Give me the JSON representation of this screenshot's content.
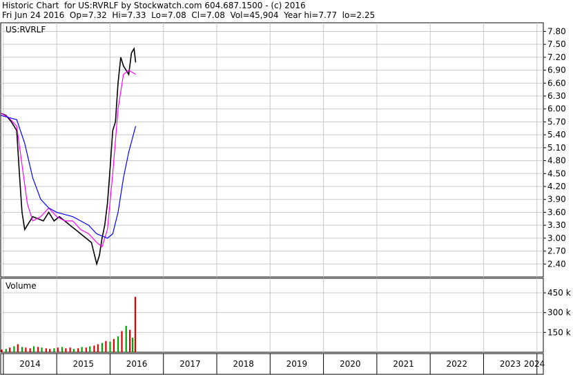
{
  "header": {
    "line1": "Historic Chart  for US:RVRLF by Stockwatch.com 604.687.1500 - (c) 2016",
    "line2": "Fri Jun 24 2016  Op=7.32  Hi=7.33  Lo=7.08  Cl=7.08  Vol=45,904  Year hi=7.77  lo=2.25"
  },
  "chart_data": [
    {
      "type": "line",
      "title": "US:RVRLF",
      "y_ticks": [
        "7.80",
        "7.50",
        "7.20",
        "6.90",
        "6.60",
        "6.30",
        "6.00",
        "5.70",
        "5.40",
        "5.10",
        "4.80",
        "4.50",
        "4.20",
        "3.90",
        "3.60",
        "3.30",
        "3.00",
        "2.70",
        "2.40"
      ],
      "ylim": [
        2.1,
        8.0
      ],
      "x_labels": [
        "2014",
        "2015",
        "2016",
        "2017",
        "2018",
        "2019",
        "2020",
        "2021",
        "2022",
        "2023",
        "2024"
      ],
      "grid": true,
      "colors": {
        "price_bars": "#000000",
        "ma_short": "#ff00ff",
        "ma_long": "#0000ff"
      },
      "series": [
        {
          "x": [
            2013.95,
            2014.05,
            2014.15,
            2014.25,
            2014.3,
            2014.35,
            2014.4,
            2014.45,
            2014.55,
            2014.65,
            2014.75,
            2014.85,
            2014.95,
            2015.05,
            2015.15,
            2015.25,
            2015.35,
            2015.45,
            2015.55,
            2015.65,
            2015.75,
            2015.8,
            2015.85,
            2015.9,
            2015.95,
            2016.0,
            2016.05,
            2016.1,
            2016.15,
            2016.2,
            2016.25,
            2016.3,
            2016.35,
            2016.4,
            2016.45,
            2016.48
          ],
          "values": [
            5.9,
            5.85,
            5.7,
            5.5,
            4.5,
            3.6,
            3.2,
            3.3,
            3.5,
            3.45,
            3.4,
            3.6,
            3.4,
            3.5,
            3.4,
            3.3,
            3.2,
            3.1,
            3.0,
            2.9,
            2.4,
            2.6,
            3.0,
            3.3,
            3.8,
            4.6,
            5.5,
            5.7,
            6.6,
            7.2,
            7.0,
            6.9,
            6.8,
            7.3,
            7.4,
            7.08
          ]
        },
        {
          "x": [
            2013.95,
            2014.1,
            2014.25,
            2014.35,
            2014.45,
            2014.55,
            2014.7,
            2014.85,
            2015.0,
            2015.15,
            2015.3,
            2015.45,
            2015.6,
            2015.75,
            2015.85,
            2015.95,
            2016.05,
            2016.15,
            2016.25,
            2016.35,
            2016.48
          ],
          "values": [
            5.9,
            5.8,
            5.6,
            4.7,
            3.8,
            3.4,
            3.5,
            3.7,
            3.5,
            3.4,
            3.4,
            3.2,
            3.1,
            2.9,
            2.8,
            3.2,
            4.5,
            6.0,
            6.8,
            6.9,
            6.8
          ]
        },
        {
          "x": [
            2013.95,
            2014.1,
            2014.25,
            2014.4,
            2014.55,
            2014.7,
            2014.85,
            2015.0,
            2015.15,
            2015.3,
            2015.45,
            2015.6,
            2015.75,
            2015.85,
            2015.95,
            2016.05,
            2016.15,
            2016.25,
            2016.35,
            2016.48
          ],
          "values": [
            5.85,
            5.8,
            5.75,
            5.2,
            4.4,
            3.9,
            3.7,
            3.6,
            3.55,
            3.5,
            3.4,
            3.3,
            3.1,
            3.05,
            3.0,
            3.1,
            3.6,
            4.4,
            5.0,
            5.6
          ]
        }
      ]
    },
    {
      "type": "bar",
      "title": "Volume",
      "y_ticks": [
        "450 k",
        "300 k",
        "150 k"
      ],
      "ylim": [
        0,
        560
      ],
      "x": [
        2013.97,
        2014.05,
        2014.12,
        2014.2,
        2014.27,
        2014.35,
        2014.42,
        2014.5,
        2014.57,
        2014.65,
        2014.72,
        2014.8,
        2014.87,
        2014.95,
        2015.02,
        2015.1,
        2015.17,
        2015.25,
        2015.32,
        2015.4,
        2015.47,
        2015.55,
        2015.62,
        2015.7,
        2015.77,
        2015.85,
        2015.92,
        2016.0,
        2016.07,
        2016.15,
        2016.22,
        2016.3,
        2016.37,
        2016.42,
        2016.47
      ],
      "values": [
        20,
        25,
        35,
        45,
        60,
        40,
        35,
        30,
        45,
        40,
        35,
        30,
        25,
        30,
        35,
        40,
        30,
        35,
        25,
        30,
        40,
        35,
        45,
        50,
        60,
        70,
        85,
        80,
        100,
        120,
        160,
        200,
        170,
        110,
        420
      ],
      "up": [
        false,
        true,
        false,
        true,
        false,
        true,
        false,
        false,
        true,
        false,
        true,
        false,
        false,
        true,
        false,
        true,
        false,
        false,
        true,
        false,
        true,
        false,
        true,
        false,
        false,
        true,
        false,
        true,
        false,
        true,
        false,
        true,
        false,
        true,
        false
      ]
    }
  ]
}
